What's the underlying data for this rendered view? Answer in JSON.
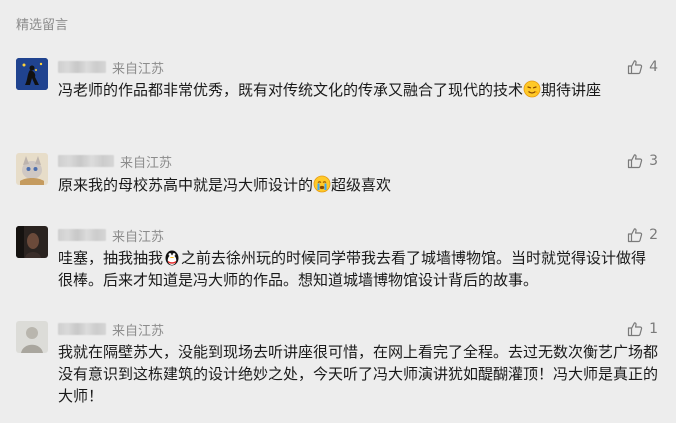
{
  "section_title": "精选留言",
  "colors": {
    "accent": "#576b95",
    "background": "#ededed",
    "secondary_text": "#8c8c8c"
  },
  "comments": [
    {
      "source": "来自江苏",
      "likes": "4",
      "text_a": "冯老师的作品都非常优秀，既有对传统文化的传承又融合了现代的技术",
      "emoji": "sly-smile-emoji",
      "text_b": "期待讲座"
    },
    {
      "source": "来自江苏",
      "likes": "3",
      "text_a": "原来我的母校苏高中就是冯大师设计的",
      "emoji": "crying-emoji",
      "text_b": "超级喜欢"
    },
    {
      "source": "来自江苏",
      "likes": "2",
      "text_a": "哇塞，抽我抽我",
      "emoji": "penguin-emoji",
      "text_b": "之前去徐州玩的时候同学带我去看了城墙博物馆。当时就觉得设计做得很棒。后来才知道是冯大师的作品。想知道城墙博物馆设计背后的故事。"
    },
    {
      "source": "来自江苏",
      "likes": "1",
      "text_a": "我就在隔壁苏大，没能到现场去听讲座很可惜，在网上看完了全程。去过无数次衡艺广场都没有意识到这栋建筑的设计绝妙之处，今天听了冯大师演讲犹如醍醐灌顶！冯大师是真正的大师！"
    }
  ]
}
